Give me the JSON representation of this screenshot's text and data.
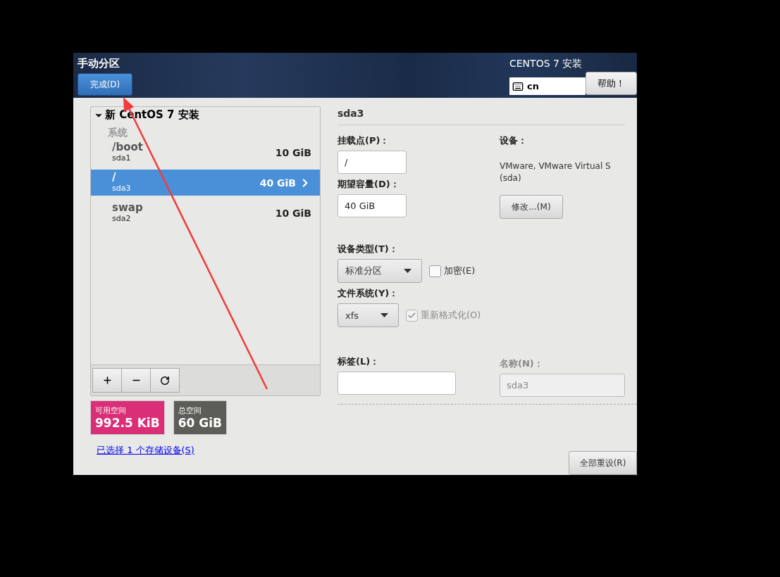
{
  "header": {
    "title": "手动分区",
    "done_button": "完成(D)",
    "product": "CENTOS 7 安装",
    "keyboard_layout": "cn",
    "help_button": "帮助！"
  },
  "partitions": {
    "root_label": "新 CentOS 7 安装",
    "expanded": true,
    "groups": [
      {
        "name": "系统",
        "items": [
          {
            "mount": "/boot",
            "device": "sda1",
            "size": "10 GiB",
            "selected": false
          },
          {
            "mount": "/",
            "device": "sda3",
            "size": "40 GiB",
            "selected": true
          },
          {
            "mount": "swap",
            "device": "sda2",
            "size": "10 GiB",
            "selected": false
          }
        ]
      }
    ]
  },
  "space": [
    {
      "label": "可用空间",
      "value": "992.5 KiB",
      "color": "#da2e76"
    },
    {
      "label": "总空间",
      "value": "60 GiB",
      "color": "#5d5d58"
    }
  ],
  "storage_link": "已选择 1 个存储设备(S)",
  "detail": {
    "title": "sda3",
    "mount_point": {
      "label": "挂载点(P)：",
      "value": "/"
    },
    "desired_capacity": {
      "label": "期望容量(D)：",
      "value": "40 GiB"
    },
    "device": {
      "label": "设备：",
      "description": [
        "VMware, VMware Virtual S",
        "(sda)"
      ],
      "modify_button": "修改...(M)"
    },
    "device_type": {
      "label": "设备类型(T)：",
      "value": "标准分区",
      "encrypt": {
        "label": "加密(E)",
        "checked": false,
        "disabled": false
      }
    },
    "file_system": {
      "label": "文件系统(Y)：",
      "value": "xfs",
      "reformat": {
        "label": "重新格式化(O)",
        "checked": true,
        "disabled": true
      }
    },
    "label_field": {
      "label": "标签(L)："
    },
    "name_field": {
      "label": "名称(N)：",
      "value": "sda3",
      "disabled": true
    }
  },
  "reset_button": "全部重设(R)"
}
